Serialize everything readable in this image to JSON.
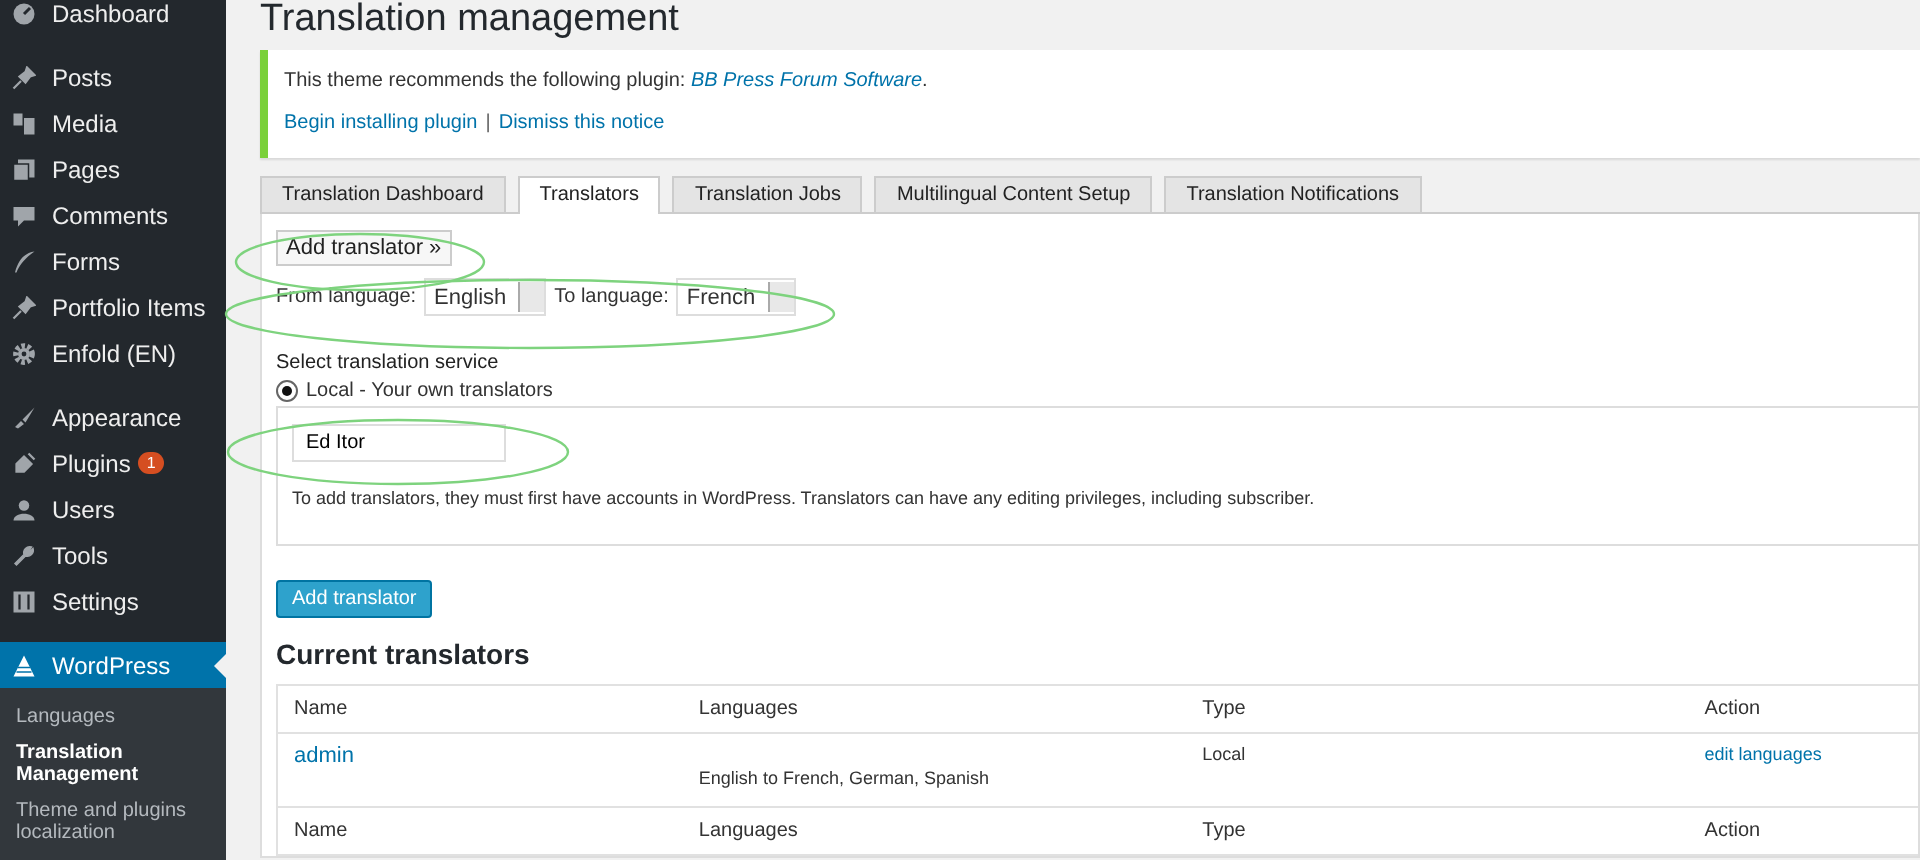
{
  "sidebar": {
    "groups": [
      {
        "items": [
          {
            "label": "Dashboard",
            "selected": false
          }
        ]
      },
      {
        "items": [
          {
            "label": "Posts",
            "selected": false
          },
          {
            "label": "Media",
            "selected": false
          },
          {
            "label": "Pages",
            "selected": false
          },
          {
            "label": "Comments",
            "selected": false
          },
          {
            "label": "Forms",
            "selected": false
          },
          {
            "label": "Portfolio Items",
            "selected": false
          },
          {
            "label": "Enfold (EN)",
            "selected": false
          }
        ]
      },
      {
        "items": [
          {
            "label": "Appearance",
            "selected": false
          },
          {
            "label": "Plugins",
            "badge": "1",
            "selected": false
          },
          {
            "label": "Users",
            "selected": false
          },
          {
            "label": "Tools",
            "selected": false
          },
          {
            "label": "Settings",
            "selected": false
          }
        ]
      },
      {
        "items": [
          {
            "label": "WordPress",
            "selected": true,
            "submenu": [
              {
                "label": "Languages",
                "selected": false
              },
              {
                "label": "Translation Management",
                "selected": true
              },
              {
                "label": "Theme and plugins localization",
                "selected": false
              }
            ]
          }
        ]
      }
    ]
  },
  "page_title": "Translation management",
  "notice": {
    "text_before": "This theme recommends the following plugin: ",
    "link": "BB Press Forum Software",
    "text_after": ".",
    "actions": [
      "Begin installing plugin",
      "Dismiss this notice"
    ],
    "separator": "|"
  },
  "tabs": [
    {
      "label": "Translation Dashboard",
      "selected": false
    },
    {
      "label": "Translators",
      "selected": true
    },
    {
      "label": "Translation Jobs",
      "selected": false
    },
    {
      "label": "Multilingual Content Setup",
      "selected": false
    },
    {
      "label": "Translation Notifications",
      "selected": false
    }
  ],
  "form": {
    "toggle_button": "Add translator »",
    "from_label": "From language:",
    "from_value": "English",
    "to_label": "To language:",
    "to_value": "French",
    "service_heading": "Select translation service",
    "service": {
      "label": "Local - Your own translators",
      "selected": true
    },
    "translator_value": "Ed Itor",
    "help": "To add translators, they must first have accounts in WordPress. Translators can have any editing privileges, including subscriber.",
    "submit": "Add translator"
  },
  "current": {
    "heading": "Current translators",
    "columns": [
      "Name",
      "Languages",
      "Type",
      "Action"
    ],
    "rows": [
      {
        "name": "admin",
        "languages": "English to French, German, Spanish",
        "type": "Local",
        "action": "edit languages"
      }
    ],
    "footer_columns": [
      "Name",
      "Languages",
      "Type",
      "Action"
    ]
  }
}
